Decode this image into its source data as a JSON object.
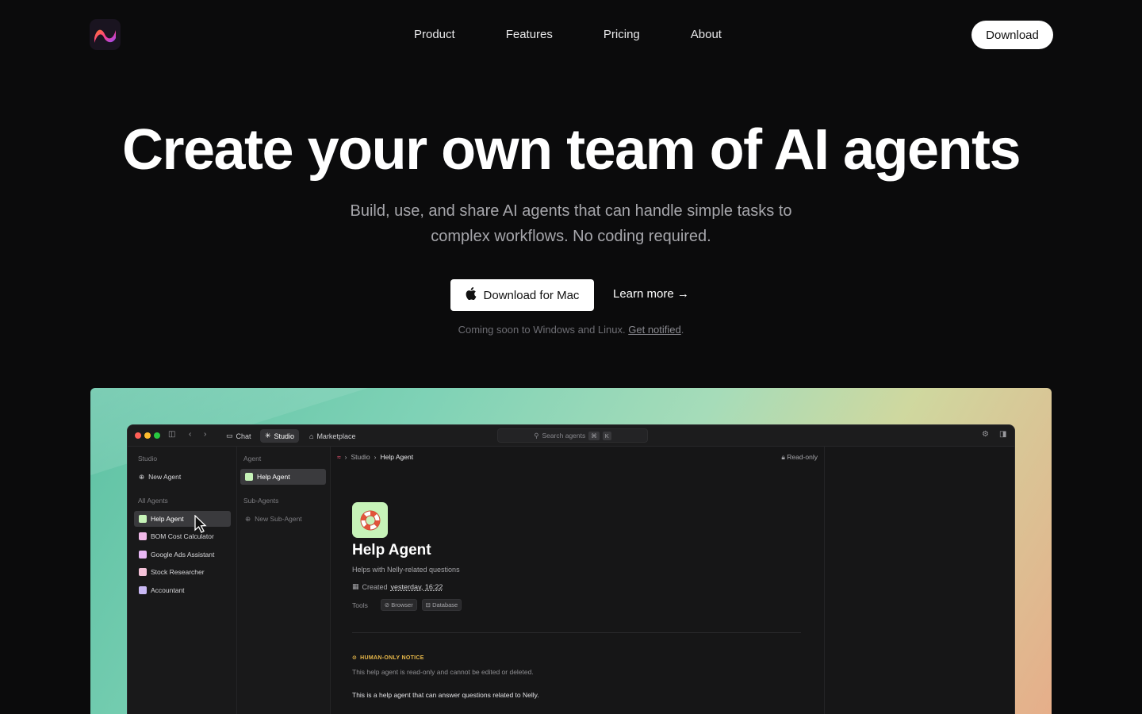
{
  "nav": {
    "links": [
      "Product",
      "Features",
      "Pricing",
      "About"
    ],
    "download_label": "Download"
  },
  "hero": {
    "title": "Create your own team of AI agents",
    "subtitle_line1": "Build, use, and share AI agents that can handle simple tasks to",
    "subtitle_line2": "complex workflows. No coding required.",
    "cta_mac": "Download for Mac",
    "cta_learn": "Learn more →",
    "soon_text": "Coming soon to Windows and Linux.",
    "soon_link": "Get notified",
    "soon_end": "."
  },
  "app": {
    "tabs": [
      "Chat",
      "Studio",
      "Marketplace"
    ],
    "search_placeholder": "Search agents",
    "kbd": [
      "⌘",
      "K"
    ],
    "studio_label": "Studio",
    "new_agent": "New Agent",
    "all_agents_label": "All Agents",
    "agents": [
      {
        "name": "Help Agent",
        "color": "#c6f3b8"
      },
      {
        "name": "BOM Cost Calculator",
        "color": "#f0b8e8"
      },
      {
        "name": "Google Ads Assistant",
        "color": "#e9b8f5"
      },
      {
        "name": "Stock Researcher",
        "color": "#f4c2d8"
      },
      {
        "name": "Accountant",
        "color": "#c9b8f4"
      }
    ],
    "agent_col_label": "Agent",
    "agent_col_item": "Help Agent",
    "subagents_label": "Sub-Agents",
    "new_subagent": "New Sub-Agent",
    "crumb": [
      "Studio",
      "Help Agent"
    ],
    "read_only": "Read-only",
    "agent_title": "Help Agent",
    "agent_desc": "Helps with Nelly-related questions",
    "created_label": "Created",
    "created_value": "yesterday, 16:22",
    "tools_label": "Tools",
    "tools": [
      "Browser",
      "Database"
    ],
    "notice_heading": "HUMAN-ONLY NOTICE",
    "notice_body": "This help agent is read-only and cannot be edited or deleted.",
    "help_text": "This is a help agent that can answer questions related to Nelly."
  },
  "colors": {
    "accent_yellow": "#e9b94a",
    "agent_icon_bg": "#c6f3b8"
  }
}
